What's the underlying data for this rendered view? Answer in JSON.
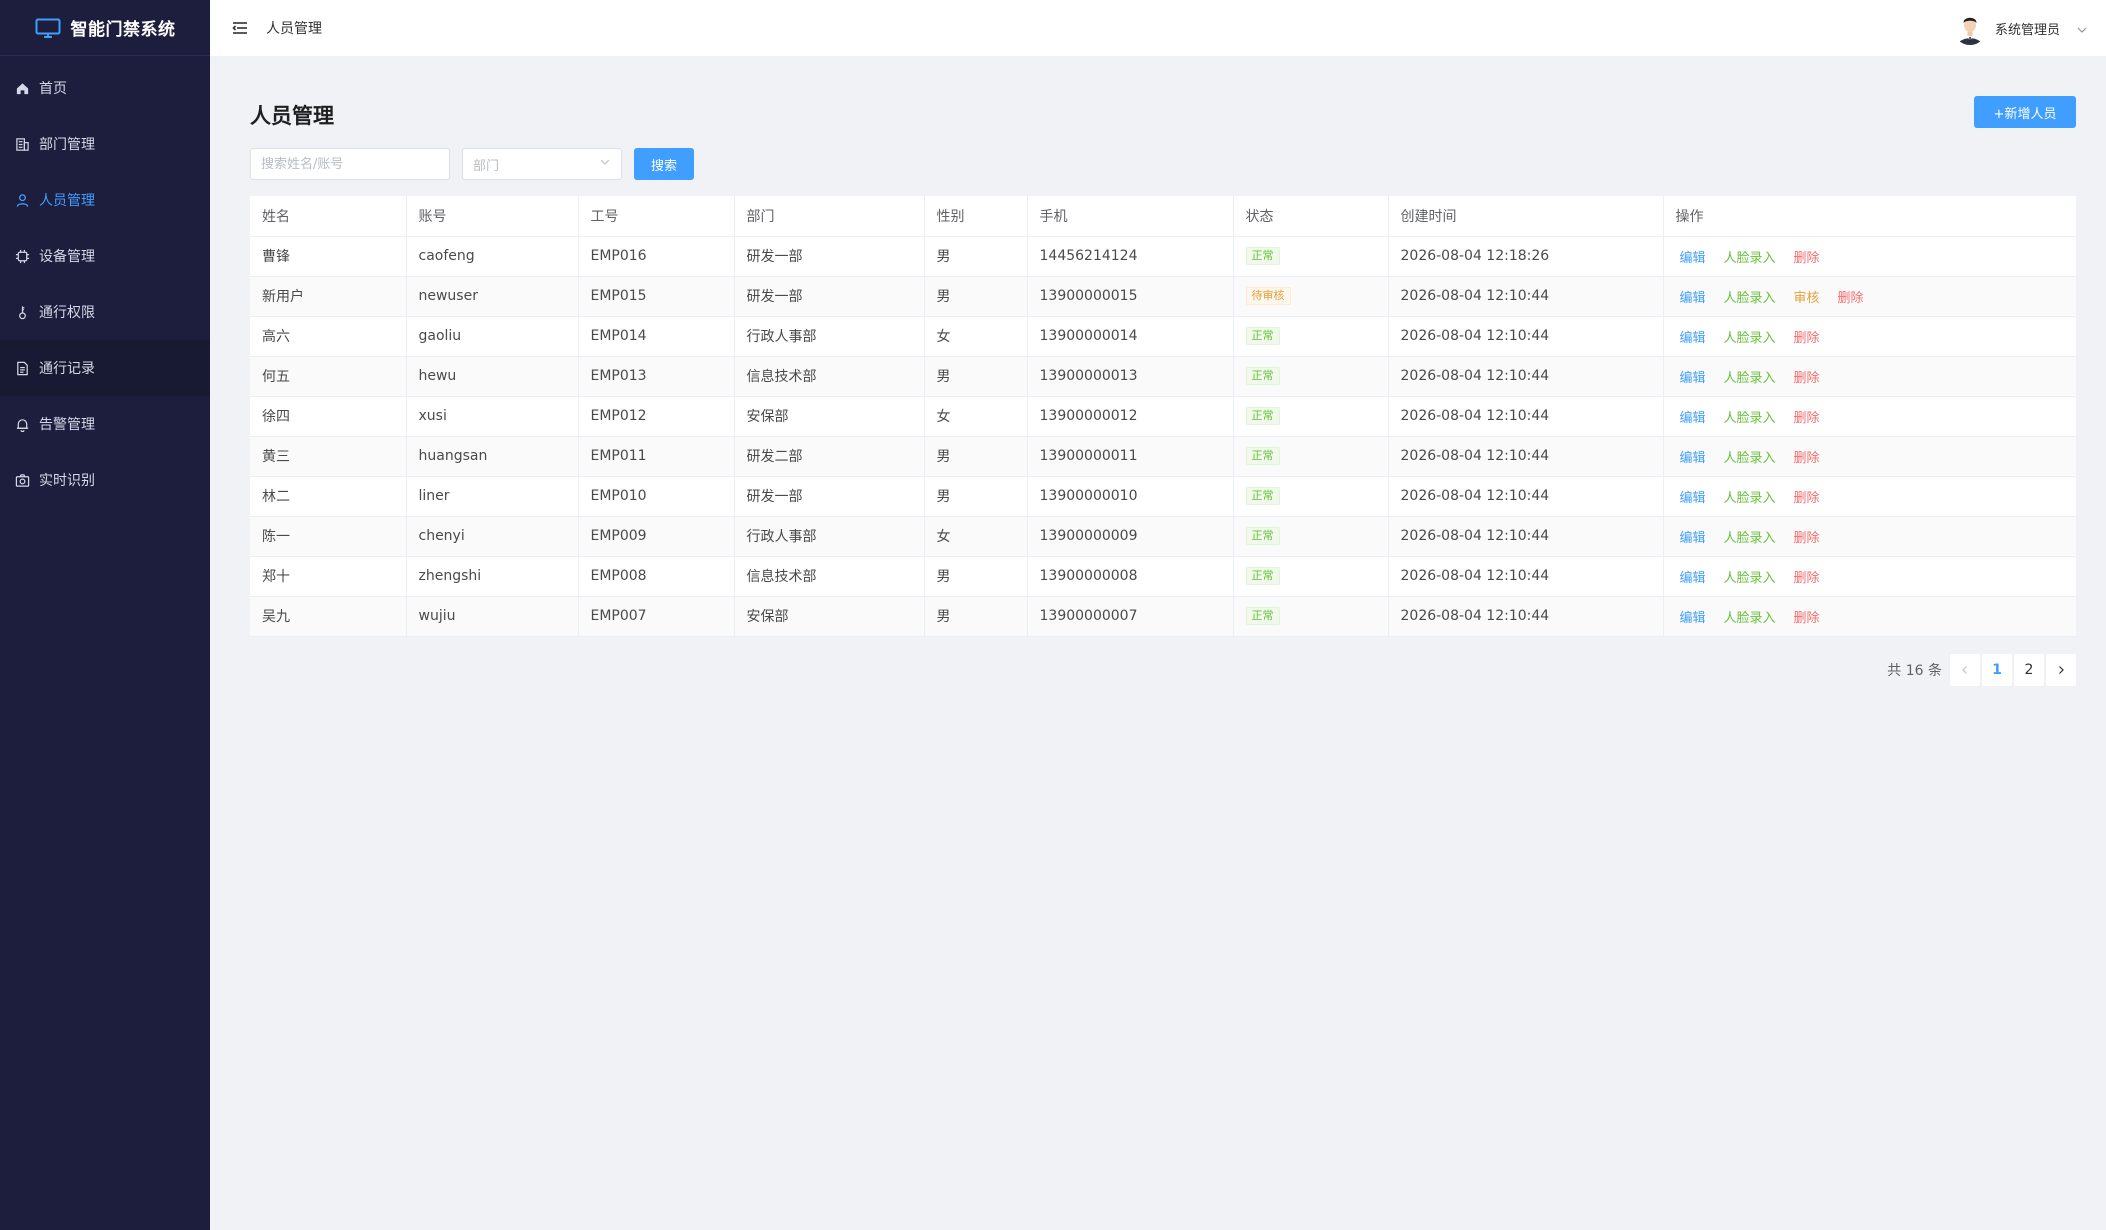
{
  "app": {
    "title": "智能门禁系统",
    "brand_icon": "monitor-icon"
  },
  "sidebar": {
    "items": [
      {
        "label": "首页",
        "icon": "home-icon",
        "active": false
      },
      {
        "label": "部门管理",
        "icon": "building-icon",
        "active": false
      },
      {
        "label": "人员管理",
        "icon": "user-icon",
        "active": true
      },
      {
        "label": "设备管理",
        "icon": "chip-icon",
        "active": false
      },
      {
        "label": "通行权限",
        "icon": "key-icon",
        "active": false
      },
      {
        "label": "通行记录",
        "icon": "document-icon",
        "active": false
      },
      {
        "label": "告警管理",
        "icon": "bell-icon",
        "active": false
      },
      {
        "label": "实时识别",
        "icon": "camera-icon",
        "active": false
      }
    ]
  },
  "header": {
    "breadcrumb": "人员管理",
    "user_name": "系统管理员"
  },
  "main": {
    "title": "人员管理",
    "add_button": "+新增人员",
    "search_placeholder": "搜索姓名/账号",
    "dept_placeholder": "部门",
    "search_button": "搜索"
  },
  "table": {
    "columns": [
      "姓名",
      "账号",
      "工号",
      "部门",
      "性别",
      "手机",
      "状态",
      "创建时间",
      "操作"
    ],
    "rows": [
      {
        "name": "曹锋",
        "account": "caofeng",
        "emp_no": "EMP016",
        "dept": "研发一部",
        "gender": "男",
        "phone": "14456214124",
        "status": "正常",
        "status_type": "ok",
        "created": "2026-08-04 12:18:26",
        "ops": [
          "编辑",
          "人脸录入",
          "删除"
        ]
      },
      {
        "name": "新用户",
        "account": "newuser",
        "emp_no": "EMP015",
        "dept": "研发一部",
        "gender": "男",
        "phone": "13900000015",
        "status": "待审核",
        "status_type": "pending",
        "created": "2026-08-04 12:10:44",
        "ops": [
          "编辑",
          "人脸录入",
          "审核",
          "删除"
        ]
      },
      {
        "name": "高六",
        "account": "gaoliu",
        "emp_no": "EMP014",
        "dept": "行政人事部",
        "gender": "女",
        "phone": "13900000014",
        "status": "正常",
        "status_type": "ok",
        "created": "2026-08-04 12:10:44",
        "ops": [
          "编辑",
          "人脸录入",
          "删除"
        ]
      },
      {
        "name": "何五",
        "account": "hewu",
        "emp_no": "EMP013",
        "dept": "信息技术部",
        "gender": "男",
        "phone": "13900000013",
        "status": "正常",
        "status_type": "ok",
        "created": "2026-08-04 12:10:44",
        "ops": [
          "编辑",
          "人脸录入",
          "删除"
        ]
      },
      {
        "name": "徐四",
        "account": "xusi",
        "emp_no": "EMP012",
        "dept": "安保部",
        "gender": "女",
        "phone": "13900000012",
        "status": "正常",
        "status_type": "ok",
        "created": "2026-08-04 12:10:44",
        "ops": [
          "编辑",
          "人脸录入",
          "删除"
        ]
      },
      {
        "name": "黄三",
        "account": "huangsan",
        "emp_no": "EMP011",
        "dept": "研发二部",
        "gender": "男",
        "phone": "13900000011",
        "status": "正常",
        "status_type": "ok",
        "created": "2026-08-04 12:10:44",
        "ops": [
          "编辑",
          "人脸录入",
          "删除"
        ]
      },
      {
        "name": "林二",
        "account": "liner",
        "emp_no": "EMP010",
        "dept": "研发一部",
        "gender": "男",
        "phone": "13900000010",
        "status": "正常",
        "status_type": "ok",
        "created": "2026-08-04 12:10:44",
        "ops": [
          "编辑",
          "人脸录入",
          "删除"
        ]
      },
      {
        "name": "陈一",
        "account": "chenyi",
        "emp_no": "EMP009",
        "dept": "行政人事部",
        "gender": "女",
        "phone": "13900000009",
        "status": "正常",
        "status_type": "ok",
        "created": "2026-08-04 12:10:44",
        "ops": [
          "编辑",
          "人脸录入",
          "删除"
        ]
      },
      {
        "name": "郑十",
        "account": "zhengshi",
        "emp_no": "EMP008",
        "dept": "信息技术部",
        "gender": "男",
        "phone": "13900000008",
        "status": "正常",
        "status_type": "ok",
        "created": "2026-08-04 12:10:44",
        "ops": [
          "编辑",
          "人脸录入",
          "删除"
        ]
      },
      {
        "name": "吴九",
        "account": "wujiu",
        "emp_no": "EMP007",
        "dept": "安保部",
        "gender": "男",
        "phone": "13900000007",
        "status": "正常",
        "status_type": "ok",
        "created": "2026-08-04 12:10:44",
        "ops": [
          "编辑",
          "人脸录入",
          "删除"
        ]
      }
    ]
  },
  "pagination": {
    "total_text": "共 16 条",
    "pages": [
      "1",
      "2"
    ],
    "current": "1"
  },
  "colors": {
    "sidebar_bg": "#1d1e3e",
    "accent": "#409eff",
    "success": "#67c23a",
    "warning": "#e6a23c",
    "danger": "#f56c6c"
  }
}
